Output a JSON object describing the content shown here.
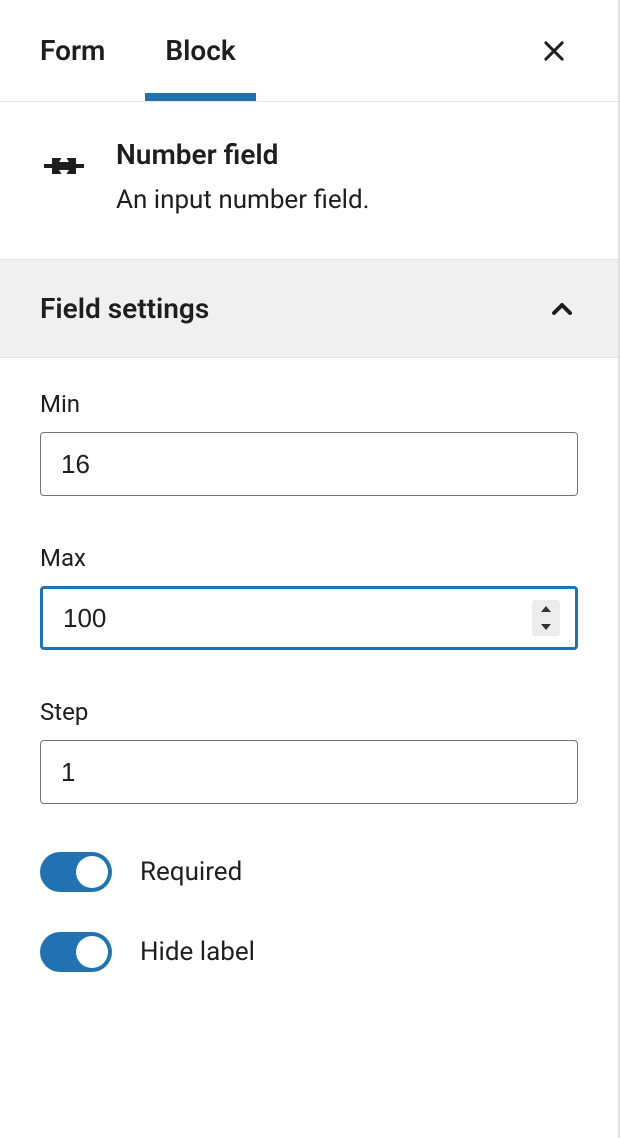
{
  "tabs": {
    "form": "Form",
    "block": "Block"
  },
  "block": {
    "title": "Number field",
    "description": "An input number field."
  },
  "panel": {
    "title": "Field settings"
  },
  "fields": {
    "min": {
      "label": "Min",
      "value": "16"
    },
    "max": {
      "label": "Max",
      "value": "100"
    },
    "step": {
      "label": "Step",
      "value": "1"
    }
  },
  "toggles": {
    "required": {
      "label": "Required",
      "on": true
    },
    "hide_label": {
      "label": "Hide label",
      "on": true
    }
  }
}
